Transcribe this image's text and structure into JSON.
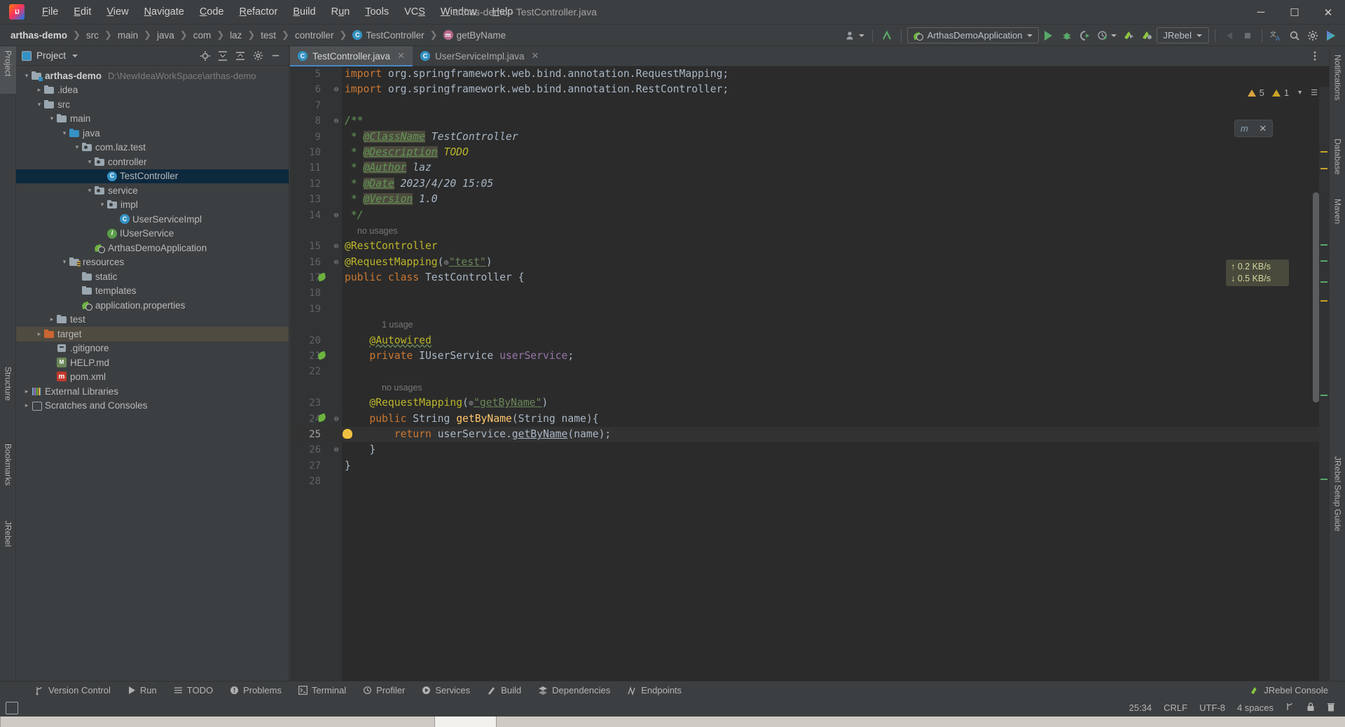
{
  "window": {
    "title": "arthas-demo - TestController.java",
    "app_icon": "intellij-idea-logo",
    "controls": {
      "minimize": "─",
      "maximize": "☐",
      "close": "✕"
    }
  },
  "menu": [
    {
      "label": "File"
    },
    {
      "label": "Edit"
    },
    {
      "label": "View"
    },
    {
      "label": "Navigate"
    },
    {
      "label": "Code"
    },
    {
      "label": "Refactor"
    },
    {
      "label": "Build"
    },
    {
      "label": "Run"
    },
    {
      "label": "Tools"
    },
    {
      "label": "VCS"
    },
    {
      "label": "Window"
    },
    {
      "label": "Help"
    }
  ],
  "breadcrumb": [
    {
      "label": "arthas-demo",
      "icon": "none",
      "root": true
    },
    {
      "label": "src",
      "icon": "none"
    },
    {
      "label": "main",
      "icon": "none"
    },
    {
      "label": "java",
      "icon": "none"
    },
    {
      "label": "com",
      "icon": "none"
    },
    {
      "label": "laz",
      "icon": "none"
    },
    {
      "label": "test",
      "icon": "none"
    },
    {
      "label": "controller",
      "icon": "none"
    },
    {
      "label": "TestController",
      "icon": "class-icon"
    },
    {
      "label": "getByName",
      "icon": "method-icon"
    }
  ],
  "toolbar": {
    "run_config": "ArthasDemoApplication",
    "jrebel_config": "JRebel",
    "icons": [
      "user-avatar-icon",
      "update-project-icon",
      "run-icon",
      "debug-icon",
      "run-coverage-icon",
      "profiler-icon",
      "jrebel-run-icon",
      "jrebel-debug-icon",
      "stop-icon-disabled",
      "stop-square-icon",
      "translate-icon",
      "search-everywhere-icon",
      "settings-gear-icon",
      "ide-assistant-icon"
    ]
  },
  "left_strip": [
    {
      "label": "Project",
      "selected": true
    },
    {
      "label": "Structure",
      "selected": false
    },
    {
      "label": "Bookmarks",
      "selected": false
    },
    {
      "label": "JRebel",
      "selected": false
    }
  ],
  "right_strip": [
    {
      "label": "Notifications"
    },
    {
      "label": "Database"
    },
    {
      "label": "Maven"
    },
    {
      "label": "JRebel Setup Guide"
    }
  ],
  "project_panel": {
    "title": "Project",
    "header_icons": [
      "locate-icon",
      "expand-all-icon",
      "collapse-all-icon",
      "settings-gear-icon",
      "hide-icon"
    ],
    "tree": [
      {
        "label": "arthas-demo",
        "path": "D:\\NewIdeaWorkSpace\\arthas-demo",
        "indent": 0,
        "arrow": "down",
        "icon": "module-folder-icon",
        "bold": true
      },
      {
        "label": ".idea",
        "path": "",
        "indent": 1,
        "arrow": "right",
        "icon": "folder-icon"
      },
      {
        "label": "src",
        "path": "",
        "indent": 1,
        "arrow": "down",
        "icon": "folder-icon"
      },
      {
        "label": "main",
        "path": "",
        "indent": 2,
        "arrow": "down",
        "icon": "folder-icon"
      },
      {
        "label": "java",
        "path": "",
        "indent": 3,
        "arrow": "down",
        "icon": "source-folder-icon"
      },
      {
        "label": "com.laz.test",
        "path": "",
        "indent": 4,
        "arrow": "down",
        "icon": "package-icon"
      },
      {
        "label": "controller",
        "path": "",
        "indent": 5,
        "arrow": "down",
        "icon": "package-icon"
      },
      {
        "label": "TestController",
        "path": "",
        "indent": 6,
        "arrow": "none",
        "icon": "class-icon",
        "selected": true
      },
      {
        "label": "service",
        "path": "",
        "indent": 5,
        "arrow": "down",
        "icon": "package-icon"
      },
      {
        "label": "impl",
        "path": "",
        "indent": 6,
        "arrow": "down",
        "icon": "package-icon"
      },
      {
        "label": "UserServiceImpl",
        "path": "",
        "indent": 7,
        "arrow": "none",
        "icon": "class-icon"
      },
      {
        "label": "IUserService",
        "path": "",
        "indent": 6,
        "arrow": "none",
        "icon": "interface-icon"
      },
      {
        "label": "ArthasDemoApplication",
        "path": "",
        "indent": 5,
        "arrow": "none",
        "icon": "spring-boot-icon"
      },
      {
        "label": "resources",
        "path": "",
        "indent": 3,
        "arrow": "down",
        "icon": "resources-folder-icon"
      },
      {
        "label": "static",
        "path": "",
        "indent": 4,
        "arrow": "none",
        "icon": "folder-icon"
      },
      {
        "label": "templates",
        "path": "",
        "indent": 4,
        "arrow": "none",
        "icon": "folder-icon"
      },
      {
        "label": "application.properties",
        "path": "",
        "indent": 4,
        "arrow": "none",
        "icon": "spring-properties-icon"
      },
      {
        "label": "test",
        "path": "",
        "indent": 2,
        "arrow": "right",
        "icon": "folder-icon"
      },
      {
        "label": "target",
        "path": "",
        "indent": 1,
        "arrow": "right",
        "icon": "excluded-folder-icon",
        "highlight": true
      },
      {
        "label": ".gitignore",
        "path": "",
        "indent": 2,
        "arrow": "none",
        "icon": "gitignore-icon"
      },
      {
        "label": "HELP.md",
        "path": "",
        "indent": 2,
        "arrow": "none",
        "icon": "markdown-icon"
      },
      {
        "label": "pom.xml",
        "path": "",
        "indent": 2,
        "arrow": "none",
        "icon": "maven-icon"
      },
      {
        "label": "External Libraries",
        "path": "",
        "indent": 0,
        "arrow": "right",
        "icon": "libraries-icon"
      },
      {
        "label": "Scratches and Consoles",
        "path": "",
        "indent": 0,
        "arrow": "right",
        "icon": "scratches-icon"
      }
    ]
  },
  "editor": {
    "tabs": [
      {
        "label": "TestController.java",
        "icon": "class-icon",
        "active": true,
        "close": "✕"
      },
      {
        "label": "UserServiceImpl.java",
        "icon": "class-icon",
        "active": false,
        "close": "✕"
      }
    ],
    "inspection": {
      "warnings": "5",
      "errors": "1",
      "warn_icon": "warning-triangle-icon",
      "err_icon": "error-triangle-icon"
    },
    "current_line": 25,
    "lines": [
      {
        "n": 5,
        "type": "code",
        "fold": "",
        "segments": [
          {
            "t": "import ",
            "c": "kw"
          },
          {
            "t": "org.springframework.web.bind.annotation.",
            "c": "type"
          },
          {
            "t": "RequestMapping",
            "c": "type"
          },
          {
            "t": ";",
            "c": "type"
          }
        ]
      },
      {
        "n": 6,
        "type": "code",
        "fold": "⊖",
        "segments": [
          {
            "t": "import ",
            "c": "kw"
          },
          {
            "t": "org.springframework.web.bind.annotation.",
            "c": "type"
          },
          {
            "t": "RestController",
            "c": "type"
          },
          {
            "t": ";",
            "c": "type"
          }
        ]
      },
      {
        "n": 7,
        "type": "code",
        "fold": "",
        "segments": []
      },
      {
        "n": 8,
        "type": "code",
        "fold": "⊖",
        "segments": [
          {
            "t": "/**",
            "c": "cmt"
          }
        ]
      },
      {
        "n": 9,
        "type": "code",
        "fold": "",
        "segments": [
          {
            "t": " * ",
            "c": "cmt"
          },
          {
            "t": "@ClassName",
            "c": "jd-tag"
          },
          {
            "t": " TestController",
            "c": "cmt-tag"
          }
        ]
      },
      {
        "n": 10,
        "type": "code",
        "fold": "",
        "segments": [
          {
            "t": " * ",
            "c": "cmt"
          },
          {
            "t": "@Description",
            "c": "jd-tag"
          },
          {
            "t": " ",
            "c": "cmt"
          },
          {
            "t": "TODO",
            "c": "todo"
          }
        ]
      },
      {
        "n": 11,
        "type": "code",
        "fold": "",
        "segments": [
          {
            "t": " * ",
            "c": "cmt"
          },
          {
            "t": "@Author",
            "c": "jd-tag"
          },
          {
            "t": " laz",
            "c": "cmt-tag"
          }
        ]
      },
      {
        "n": 12,
        "type": "code",
        "fold": "",
        "segments": [
          {
            "t": " * ",
            "c": "cmt"
          },
          {
            "t": "@Date",
            "c": "jd-tag"
          },
          {
            "t": " 2023/4/20 15:05",
            "c": "cmt-tag"
          }
        ]
      },
      {
        "n": 13,
        "type": "code",
        "fold": "",
        "segments": [
          {
            "t": " * ",
            "c": "cmt"
          },
          {
            "t": "@Version",
            "c": "jd-tag"
          },
          {
            "t": " 1.0",
            "c": "cmt-tag"
          }
        ]
      },
      {
        "n": 14,
        "type": "code",
        "fold": "⊖",
        "segments": [
          {
            "t": " */",
            "c": "cmt"
          }
        ]
      },
      {
        "n": null,
        "type": "hint",
        "text": "no usages",
        "indent": false
      },
      {
        "n": 15,
        "type": "code",
        "fold": "⊖",
        "segments": [
          {
            "t": "@RestController",
            "c": "ann"
          }
        ]
      },
      {
        "n": 16,
        "type": "code",
        "fold": "⊖",
        "gutter_icon": "",
        "segments": [
          {
            "t": "@RequestMapping",
            "c": "ann"
          },
          {
            "t": "(",
            "c": "type"
          },
          {
            "t": "⊕",
            "c": "inlay"
          },
          {
            "t": "\"test\"",
            "c": "str-u"
          },
          {
            "t": ")",
            "c": "type"
          }
        ]
      },
      {
        "n": 17,
        "type": "code",
        "fold": "",
        "gutter_icon": "spring-bean-icon",
        "segments": [
          {
            "t": "public ",
            "c": "kw"
          },
          {
            "t": "class ",
            "c": "kw"
          },
          {
            "t": "TestController",
            "c": "type"
          },
          {
            "t": " {",
            "c": "type"
          }
        ]
      },
      {
        "n": 18,
        "type": "code",
        "fold": "",
        "segments": []
      },
      {
        "n": 19,
        "type": "code",
        "fold": "",
        "segments": []
      },
      {
        "n": null,
        "type": "hint",
        "text": "1 usage",
        "indent": true
      },
      {
        "n": 20,
        "type": "code",
        "fold": "",
        "segments": [
          {
            "t": "    ",
            "c": "type"
          },
          {
            "t": "@Autowired",
            "c": "ann-wavy"
          }
        ]
      },
      {
        "n": 21,
        "type": "code",
        "fold": "",
        "gutter_icon": "spring-autowire-icon",
        "segments": [
          {
            "t": "    ",
            "c": "type"
          },
          {
            "t": "private ",
            "c": "kw"
          },
          {
            "t": "IUserService ",
            "c": "type"
          },
          {
            "t": "userService",
            "c": "field"
          },
          {
            "t": ";",
            "c": "type"
          }
        ]
      },
      {
        "n": 22,
        "type": "code",
        "fold": "",
        "segments": []
      },
      {
        "n": null,
        "type": "hint",
        "text": "no usages",
        "indent": true
      },
      {
        "n": 23,
        "type": "code",
        "fold": "",
        "segments": [
          {
            "t": "    ",
            "c": "type"
          },
          {
            "t": "@RequestMapping",
            "c": "ann"
          },
          {
            "t": "(",
            "c": "type"
          },
          {
            "t": "⊕",
            "c": "inlay"
          },
          {
            "t": "\"getByName\"",
            "c": "str-u"
          },
          {
            "t": ")",
            "c": "type"
          }
        ]
      },
      {
        "n": 24,
        "type": "code",
        "fold": "⊖",
        "gutter_icon": "spring-mapping-icon",
        "segments": [
          {
            "t": "    ",
            "c": "type"
          },
          {
            "t": "public ",
            "c": "kw"
          },
          {
            "t": "String ",
            "c": "type"
          },
          {
            "t": "getByName",
            "c": "meth"
          },
          {
            "t": "(",
            "c": "type"
          },
          {
            "t": "String ",
            "c": "type"
          },
          {
            "t": "name",
            "c": "type"
          },
          {
            "t": "){",
            "c": "type"
          }
        ]
      },
      {
        "n": 25,
        "type": "code",
        "fold": "",
        "current": true,
        "gutter_icon": "intention-bulb-icon",
        "segments": [
          {
            "t": "        ",
            "c": "type"
          },
          {
            "t": "return ",
            "c": "kw"
          },
          {
            "t": "userService",
            "c": "type"
          },
          {
            "t": ".",
            "c": "type"
          },
          {
            "t": "getByName",
            "c": "meth-u"
          },
          {
            "t": "(",
            "c": "type"
          },
          {
            "t": "name",
            "c": "type"
          },
          {
            "t": ");",
            "c": "type"
          }
        ]
      },
      {
        "n": 26,
        "type": "code",
        "fold": "⊖",
        "segments": [
          {
            "t": "    }",
            "c": "type"
          }
        ]
      },
      {
        "n": 27,
        "type": "code",
        "fold": "",
        "segments": [
          {
            "t": "}",
            "c": "type"
          }
        ]
      },
      {
        "n": 28,
        "type": "code",
        "fold": "",
        "segments": []
      }
    ]
  },
  "network_monitor": {
    "upload": "↑ 0.2 KB/s",
    "download": "↓ 0.5 KB/s"
  },
  "bottom_bar": [
    {
      "label": "Version Control",
      "icon": "branch-icon"
    },
    {
      "label": "Run",
      "icon": "run-triangle-icon"
    },
    {
      "label": "TODO",
      "icon": "todo-list-icon"
    },
    {
      "label": "Problems",
      "icon": "problems-icon"
    },
    {
      "label": "Terminal",
      "icon": "terminal-icon"
    },
    {
      "label": "Profiler",
      "icon": "profiler-icon"
    },
    {
      "label": "Services",
      "icon": "services-icon"
    },
    {
      "label": "Build",
      "icon": "build-hammer-icon"
    },
    {
      "label": "Dependencies",
      "icon": "dependencies-icon"
    },
    {
      "label": "Endpoints",
      "icon": "endpoints-icon"
    }
  ],
  "bottom_bar_right": {
    "label": "JRebel Console",
    "icon": "jrebel-icon"
  },
  "status_bar": {
    "left_icon": "toggle-toolwindow-icon",
    "caret": "25:34",
    "line_sep": "CRLF",
    "encoding": "UTF-8",
    "indent": "4 spaces",
    "branch_icon": "git-branch-icon",
    "lock_icon": "lock-icon"
  }
}
